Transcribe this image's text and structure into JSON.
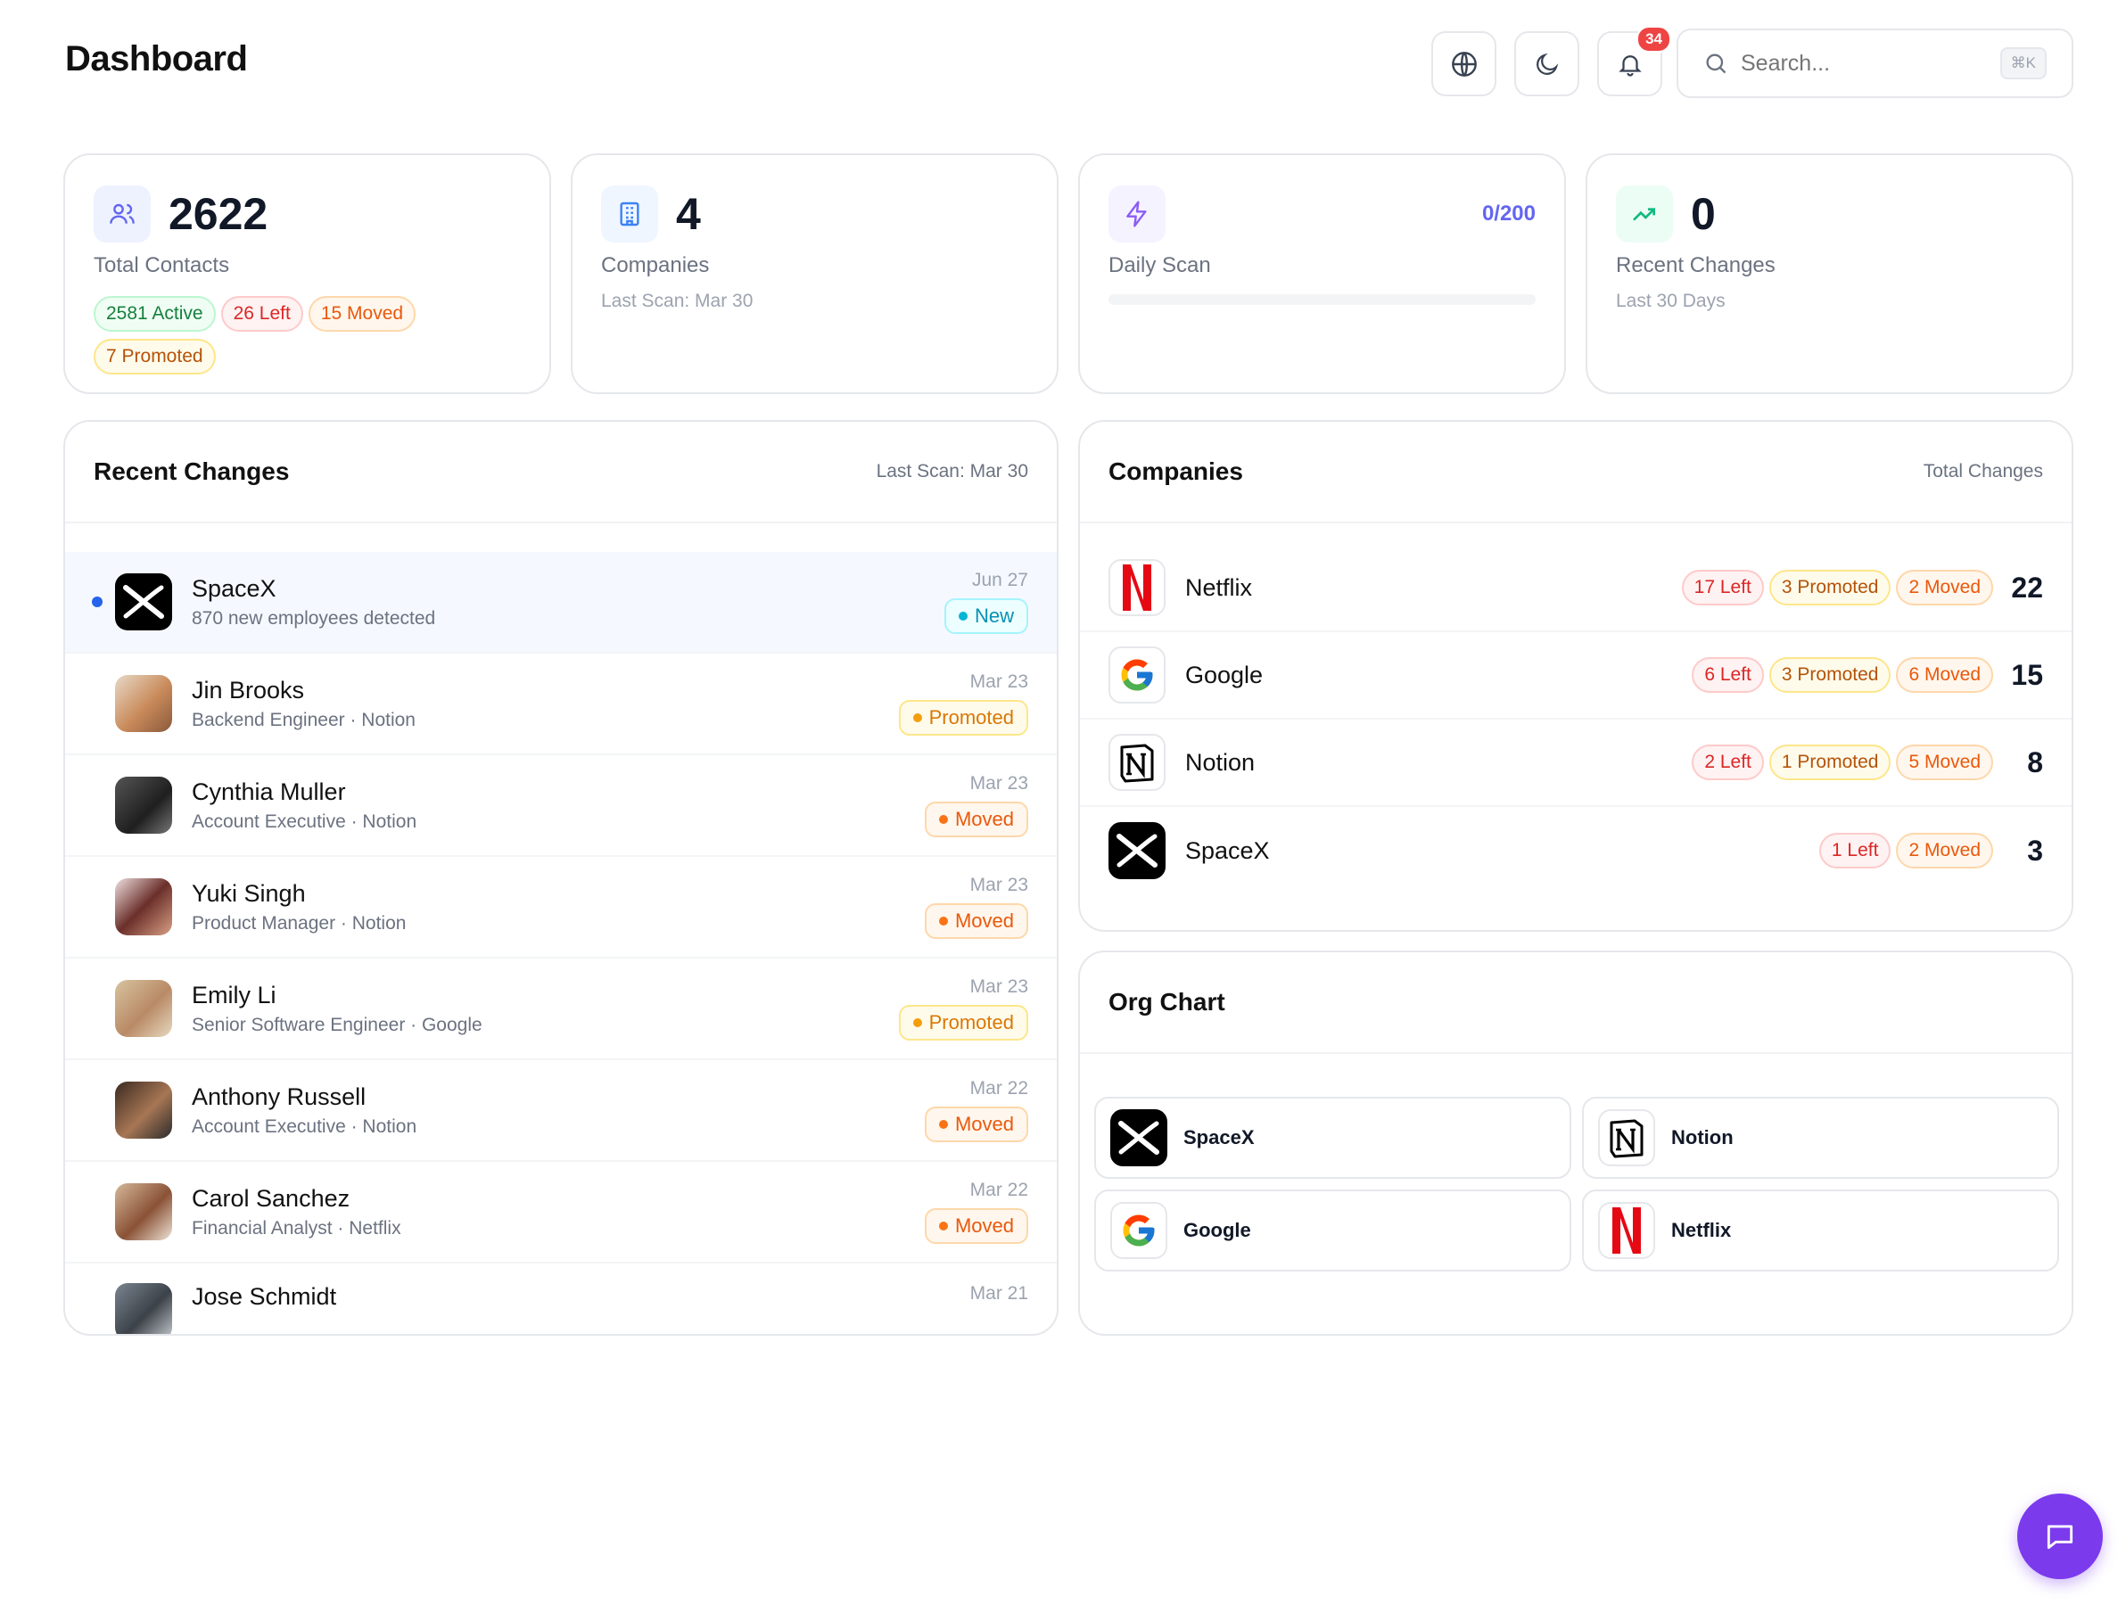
{
  "header": {
    "title": "Dashboard",
    "notification_count": "34",
    "search_placeholder": "Search...",
    "search_shortcut": "⌘K"
  },
  "stats": {
    "contacts": {
      "value": "2622",
      "label": "Total Contacts",
      "pills": {
        "active": "2581 Active",
        "left": "26 Left",
        "moved": "15 Moved",
        "promoted": "7 Promoted"
      }
    },
    "companies": {
      "value": "4",
      "label": "Companies",
      "sub": "Last Scan: Mar 30"
    },
    "daily_scan": {
      "value": "0/200",
      "label": "Daily Scan",
      "progress": 0
    },
    "recent_changes": {
      "value": "0",
      "label": "Recent Changes",
      "sub": "Last 30 Days"
    }
  },
  "recent": {
    "title": "Recent Changes",
    "meta": "Last Scan: Mar 30",
    "items": [
      {
        "name": "SpaceX",
        "sub": "870 new employees detected",
        "date": "Jun 27",
        "status": "New"
      },
      {
        "name": "Jin Brooks",
        "sub": "Backend Engineer · Notion",
        "date": "Mar 23",
        "status": "Promoted"
      },
      {
        "name": "Cynthia Muller",
        "sub": "Account Executive · Notion",
        "date": "Mar 23",
        "status": "Moved"
      },
      {
        "name": "Yuki Singh",
        "sub": "Product Manager · Notion",
        "date": "Mar 23",
        "status": "Moved"
      },
      {
        "name": "Emily Li",
        "sub": "Senior Software Engineer · Google",
        "date": "Mar 23",
        "status": "Promoted"
      },
      {
        "name": "Anthony Russell",
        "sub": "Account Executive · Notion",
        "date": "Mar 22",
        "status": "Moved"
      },
      {
        "name": "Carol Sanchez",
        "sub": "Financial Analyst · Netflix",
        "date": "Mar 22",
        "status": "Moved"
      },
      {
        "name": "Jose Schmidt",
        "sub": "",
        "date": "Mar 21",
        "status": ""
      }
    ]
  },
  "companies": {
    "title": "Companies",
    "meta": "Total Changes",
    "items": [
      {
        "name": "Netflix",
        "left": "17 Left",
        "promoted": "3 Promoted",
        "moved": "2 Moved",
        "total": "22"
      },
      {
        "name": "Google",
        "left": "6 Left",
        "promoted": "3 Promoted",
        "moved": "6 Moved",
        "total": "15"
      },
      {
        "name": "Notion",
        "left": "2 Left",
        "promoted": "1 Promoted",
        "moved": "5 Moved",
        "total": "8"
      },
      {
        "name": "SpaceX",
        "left": "1 Left",
        "moved": "2 Moved",
        "total": "3"
      }
    ]
  },
  "org_chart": {
    "title": "Org Chart",
    "items": [
      "SpaceX",
      "Notion",
      "Google",
      "Netflix"
    ]
  },
  "colors": {
    "accent": "#7c3aed",
    "progress_text": "#6366f1",
    "new_dot": "#2563eb"
  }
}
